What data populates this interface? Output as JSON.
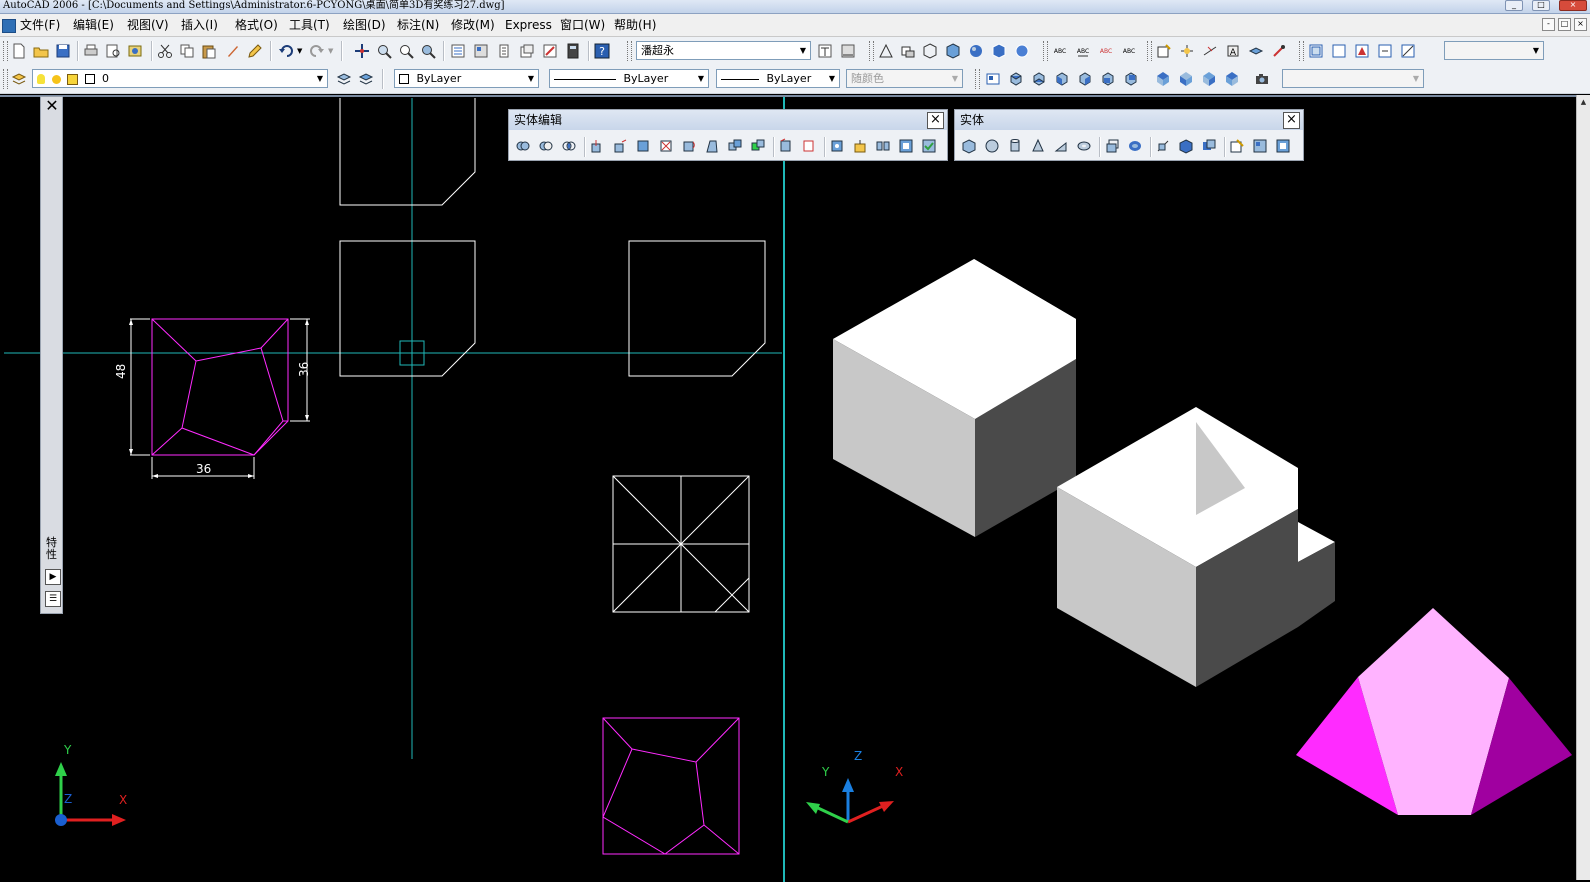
{
  "window": {
    "title": "AutoCAD 2006 - [C:\\Documents and Settings\\Administrator.6-PCYONG\\桌面\\简单3D有奖练习27.dwg]",
    "btn_min": "_",
    "btn_max": "□",
    "btn_close": "×"
  },
  "menu": {
    "items": [
      "文件(F)",
      "编辑(E)",
      "视图(V)",
      "插入(I)",
      "格式(O)",
      "工具(T)",
      "绘图(D)",
      "标注(N)",
      "修改(M)",
      "Express",
      "窗口(W)",
      "帮助(H)"
    ],
    "mdi_min": "-",
    "mdi_max": "□",
    "mdi_close": "×"
  },
  "toolbar1": {
    "textstyle_value": "潘超永",
    "dropdown_arrow": "▼"
  },
  "toolbar2": {
    "layer_value": "0",
    "color_value": "ByLayer",
    "linetype_value": "ByLayer",
    "lineweight_value": "ByLayer",
    "plotstyle_value": "随颜色",
    "dropdown_arrow": "▼"
  },
  "properties_palette": {
    "close_glyph": "✕",
    "title_vertical": "特性"
  },
  "palette_solid_edit": {
    "title": "实体编辑",
    "close": "×"
  },
  "palette_solids": {
    "title": "实体",
    "close": "×"
  },
  "drawing": {
    "dim_height": "48",
    "dim_right": "36",
    "dim_bottom": "36",
    "ucs_left": {
      "x": "X",
      "y": "Y",
      "z": "Z"
    },
    "ucs_right": {
      "x": "X",
      "y": "Y",
      "z": "Z"
    }
  },
  "colors": {
    "crosshair": "#1fb8b8",
    "magenta_line": "#ff2bff",
    "white_line": "#ffffff",
    "pyramid_left": "#ff2bff",
    "pyramid_front": "#ffb3ff",
    "pyramid_right": "#a000a0",
    "cube_top": "#ffffff",
    "cube_left": "#c8c8c8",
    "cube_right": "#4a4a4a"
  }
}
